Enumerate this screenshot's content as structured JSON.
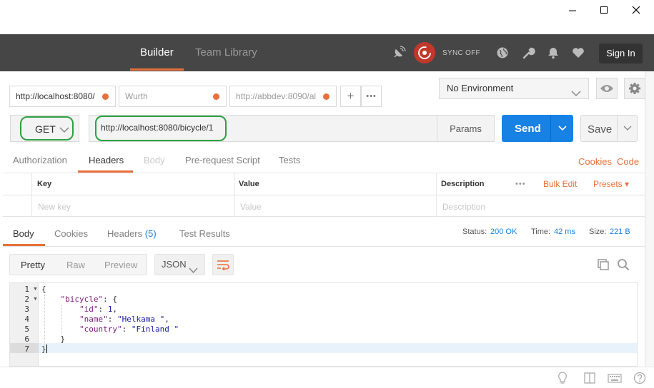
{
  "window": {
    "minimize_icon": "minimize-icon",
    "maximize_icon": "maximize-icon",
    "close_icon": "close-icon"
  },
  "header": {
    "tabs": [
      {
        "label": "Builder",
        "active": true
      },
      {
        "label": "Team Library",
        "active": false
      }
    ],
    "sync_status": "SYNC OFF",
    "sign_in_label": "Sign In",
    "accent_color": "#e8703a"
  },
  "request_tabs": [
    {
      "label": "http://localhost:8080/",
      "unsaved": true
    },
    {
      "label": "Wurth",
      "unsaved": true
    },
    {
      "label": "http://abbdev:8090/al",
      "unsaved": true
    }
  ],
  "new_tab_label": "+",
  "more_label": "•••",
  "environment": {
    "selected": "No Environment"
  },
  "request": {
    "method": "GET",
    "url": "http://localhost:8080/bicycle/1",
    "params_label": "Params",
    "send_label": "Send",
    "save_label": "Save"
  },
  "request_subtabs": [
    {
      "label": "Authorization",
      "state": "normal"
    },
    {
      "label": "Headers",
      "state": "active"
    },
    {
      "label": "Body",
      "state": "disabled"
    },
    {
      "label": "Pre-request Script",
      "state": "normal"
    },
    {
      "label": "Tests",
      "state": "normal"
    }
  ],
  "request_links": {
    "cookies": "Cookies",
    "code": "Code"
  },
  "headers_table": {
    "columns": [
      "Key",
      "Value",
      "Description"
    ],
    "more": "•••",
    "bulk_edit": "Bulk Edit",
    "presets": "Presets ▾",
    "placeholders": {
      "key": "New key",
      "value": "Value",
      "description": "Description"
    }
  },
  "response_tabs": [
    {
      "label": "Body",
      "active": true
    },
    {
      "label": "Cookies",
      "active": false
    },
    {
      "label": "Headers",
      "count": "(5)",
      "active": false
    },
    {
      "label": "Test Results",
      "active": false
    }
  ],
  "response_status": {
    "status_label": "Status:",
    "status_value": "200 OK",
    "time_label": "Time:",
    "time_value": "42 ms",
    "size_label": "Size:",
    "size_value": "221 B"
  },
  "view_modes": [
    "Pretty",
    "Raw",
    "Preview"
  ],
  "active_view": "Pretty",
  "format": "JSON",
  "response_body": {
    "line_numbers": [
      "1",
      "2",
      "3",
      "4",
      "5",
      "6",
      "7"
    ],
    "lines": [
      "{",
      "    \"bicycle\": {",
      "        \"id\": 1,",
      "        \"name\": \"Helkama \",",
      "        \"country\": \"Finland \"",
      "    }",
      "}"
    ],
    "tokens": {
      "open_brace": "{",
      "close_brace": "}",
      "colon_space": ": ",
      "colon_space_brace": ": {",
      "comma": ",",
      "bicycle_key": "\"bicycle\"",
      "id_key": "\"id\"",
      "id_value": "1",
      "name_key": "\"name\"",
      "name_value": "\"Helkama \"",
      "country_key": "\"country\"",
      "country_value": "\"Finland \""
    }
  },
  "footer_icons": [
    "bulb-icon",
    "two-pane-icon",
    "keyboard-icon",
    "help-icon"
  ]
}
